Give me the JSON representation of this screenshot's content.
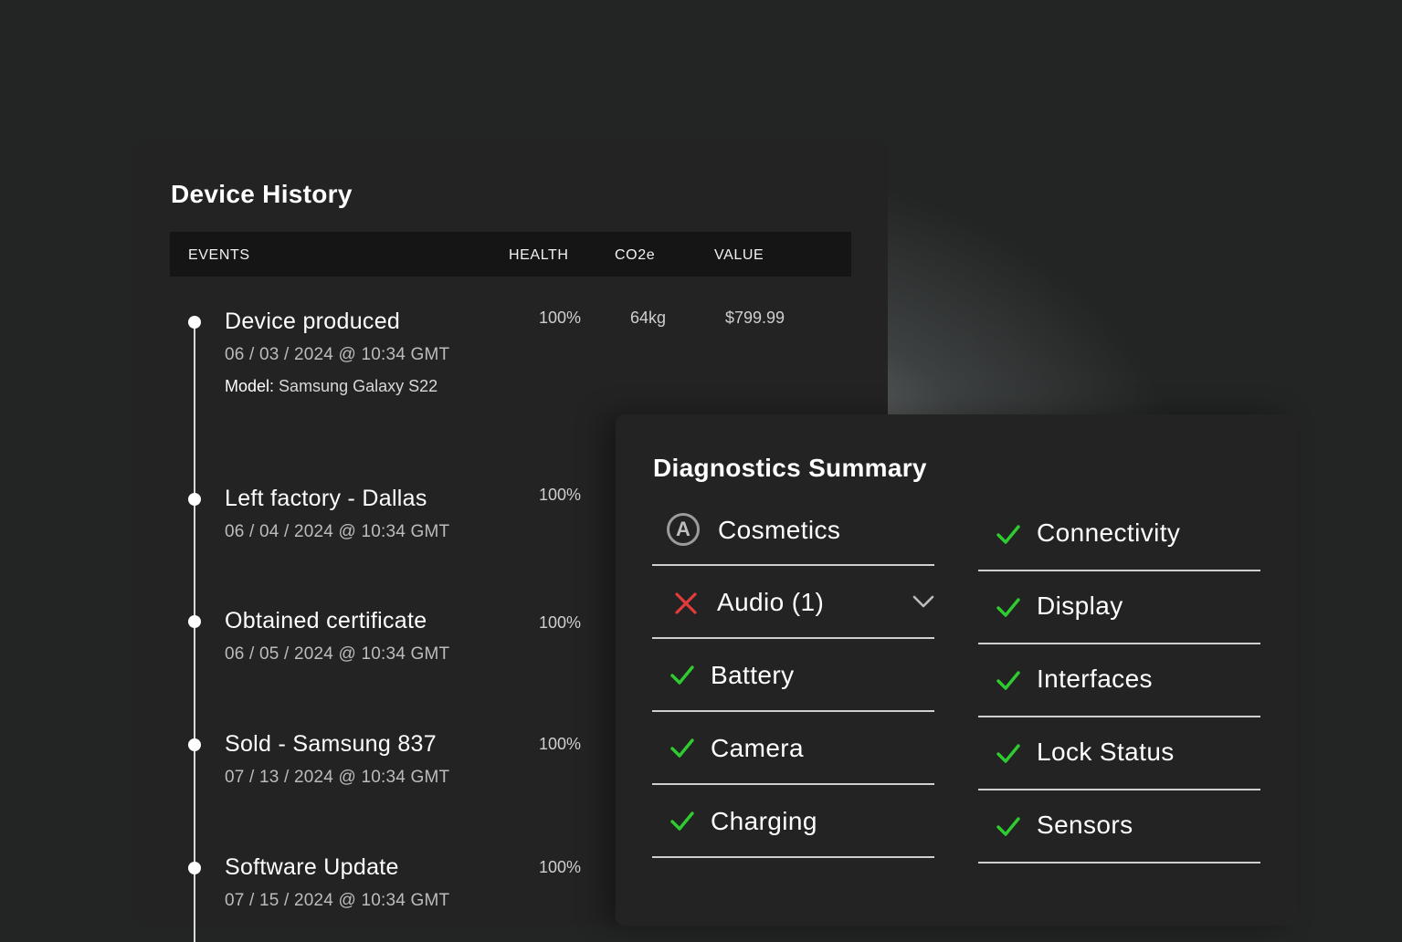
{
  "history": {
    "title": "Device History",
    "columns": {
      "events": "EVENTS",
      "health": "HEALTH",
      "co2e": "CO2e",
      "value": "VALUE"
    },
    "events": [
      {
        "title": "Device produced",
        "date": "06 / 03 / 2024 @ 10:34 GMT",
        "model_label": "Model:",
        "model_value": "Samsung Galaxy S22",
        "health": "100%",
        "co2e": "64kg",
        "value": "$799.99"
      },
      {
        "title": "Left factory - Dallas",
        "date": "06 / 04 / 2024 @ 10:34 GMT",
        "health": "100%"
      },
      {
        "title": "Obtained certificate",
        "date": "06 / 05 / 2024 @ 10:34 GMT",
        "health": "100%"
      },
      {
        "title": "Sold - Samsung 837",
        "date": "07 / 13 / 2024 @ 10:34 GMT",
        "health": "100%"
      },
      {
        "title": "Software Update",
        "date": "07 / 15 / 2024 @ 10:34 GMT",
        "health": "100%"
      }
    ]
  },
  "diagnostics": {
    "title": "Diagnostics Summary",
    "left": [
      {
        "label": "Cosmetics",
        "status": "grade",
        "grade": "A"
      },
      {
        "label": "Audio (1)",
        "status": "fail"
      },
      {
        "label": "Battery",
        "status": "pass"
      },
      {
        "label": "Camera",
        "status": "pass"
      },
      {
        "label": "Charging",
        "status": "pass"
      }
    ],
    "right": [
      {
        "label": "Connectivity",
        "status": "pass"
      },
      {
        "label": "Display",
        "status": "pass"
      },
      {
        "label": "Interfaces",
        "status": "pass"
      },
      {
        "label": "Lock Status",
        "status": "pass"
      },
      {
        "label": "Sensors",
        "status": "pass"
      }
    ]
  },
  "colors": {
    "pass": "#2ecc2e",
    "fail": "#e23b3b",
    "panel": "#232323",
    "header": "#151515"
  }
}
